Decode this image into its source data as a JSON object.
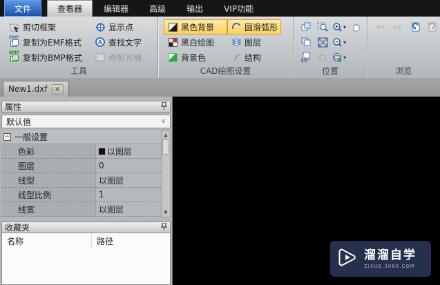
{
  "menubar": {
    "items": [
      {
        "label": "文件"
      },
      {
        "label": "查看器"
      },
      {
        "label": "编辑器"
      },
      {
        "label": "高级"
      },
      {
        "label": "输出"
      },
      {
        "label": "VIP功能"
      }
    ]
  },
  "ribbon": {
    "groups": {
      "tools": "工具",
      "cad": "CAD绘图设置",
      "position": "位置",
      "browse": "浏览"
    },
    "tools": {
      "cut": "剪切框架",
      "copy_emf": "复制为EMF格式",
      "copy_bmp": "复制为BMP格式",
      "show_points": "显示点",
      "find_text": "查找文字",
      "trim_raster": "修剪光栅",
      "emf_badge": "EMF",
      "bmp_badge": "BMP",
      "find_letter": "A"
    },
    "cad": {
      "black_bg": "黑色背景",
      "bw_drawing": "黑白绘图",
      "bg_color": "背景色",
      "smooth_arc": "圆滑弧形",
      "layers": "图层",
      "structure": "结构"
    },
    "position": {
      "rotate_badge": "35°"
    }
  },
  "tabbar": {
    "tab": "New1.dxf",
    "close": "×"
  },
  "properties": {
    "title": "属性",
    "preset": "默认值",
    "group": "一般设置",
    "rows": [
      {
        "label": "色彩",
        "value": "以图层"
      },
      {
        "label": "图层",
        "value": "0"
      },
      {
        "label": "线型",
        "value": "以图层"
      },
      {
        "label": "线型比例",
        "value": "1"
      },
      {
        "label": "线宽",
        "value": "以图层"
      }
    ]
  },
  "favorites": {
    "title": "收藏夹",
    "name_col": "名称",
    "path_col": "路径"
  },
  "watermark": {
    "title": "溜溜自学",
    "subtitle": "ZIXUE.3066.COM"
  },
  "colors": {
    "menubar_bg": "#161616",
    "file_button_blue": "#1c52a8",
    "toggle_orange_border": "#d89c1e",
    "toggle_orange_fill": "#fcd25e",
    "canvas": "#000000",
    "watermark_bg": "#26304e"
  }
}
